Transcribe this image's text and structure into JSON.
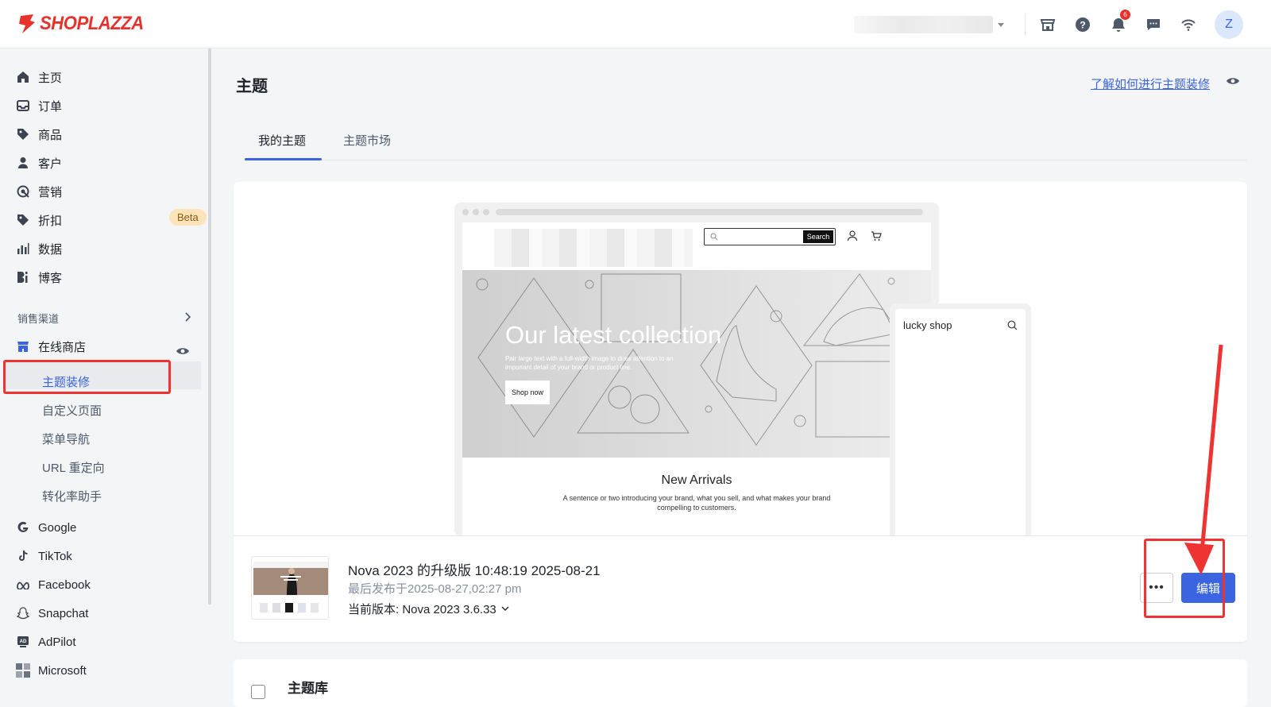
{
  "brand": {
    "logo_text": "SHOPLAZZA"
  },
  "topbar": {
    "notification_count": "6",
    "avatar_initial": "Z"
  },
  "sidebar": {
    "items": [
      {
        "label": "主页"
      },
      {
        "label": "订单"
      },
      {
        "label": "商品"
      },
      {
        "label": "客户"
      },
      {
        "label": "营销"
      },
      {
        "label": "折扣"
      },
      {
        "label": "数据"
      },
      {
        "label": "博客"
      }
    ],
    "discount_badge": "Beta",
    "section_label": "销售渠道",
    "online_store": "在线商店",
    "sub_items": [
      {
        "label": "主题装修"
      },
      {
        "label": "自定义页面"
      },
      {
        "label": "菜单导航"
      },
      {
        "label": "URL 重定向"
      },
      {
        "label": "转化率助手"
      }
    ],
    "channels": [
      {
        "label": "Google"
      },
      {
        "label": "TikTok"
      },
      {
        "label": "Facebook"
      },
      {
        "label": "Snapchat"
      },
      {
        "label": "AdPilot"
      },
      {
        "label": "Microsoft"
      }
    ]
  },
  "main": {
    "title": "主题",
    "help_link": "了解如何进行主题装修",
    "tabs": [
      {
        "label": "我的主题"
      },
      {
        "label": "主题市场"
      }
    ]
  },
  "preview": {
    "search_button": "Search",
    "hero_title": "Our latest collection",
    "hero_sub": "Pair large text with a full-width image to draw attention to an important detail of your brand or product line.",
    "hero_button": "Shop now",
    "arrivals_title": "New Arrivals",
    "arrivals_sub": "A sentence or two introducing your brand, what you sell, and what makes your brand compelling to customers.",
    "mobile_shop_name": "lucky shop"
  },
  "theme": {
    "name": "Nova 2023 的升级版 10:48:19 2025-08-21",
    "published": "最后发布于2025-08-27,02:27 pm",
    "version": "当前版本: Nova 2023 3.6.33",
    "more_label": "•••",
    "edit_label": "编辑"
  },
  "library": {
    "title": "主题库"
  },
  "colors": {
    "accent": "#3a64e0",
    "brand": "#e5322d",
    "highlight": "#e33333"
  }
}
